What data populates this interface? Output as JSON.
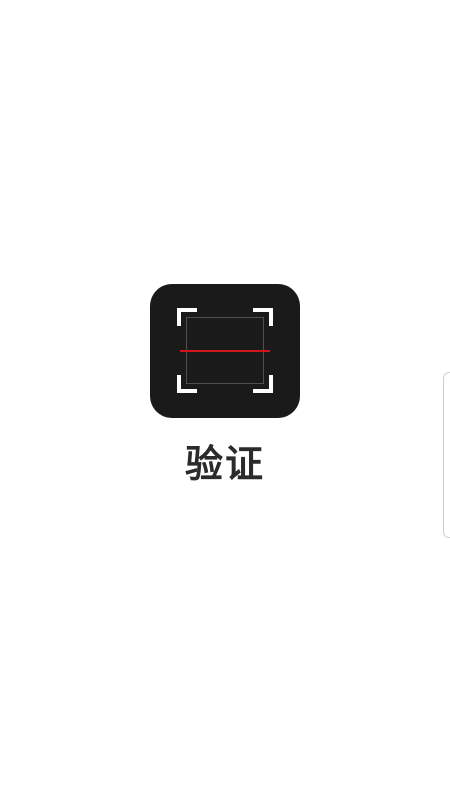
{
  "app": {
    "title": "验证",
    "icon": "scanner-icon"
  },
  "colors": {
    "background": "#ffffff",
    "icon_background": "#1b1a1b",
    "scan_line": "#d0161a",
    "title_text": "#2b2b2b"
  },
  "edge_panel": {
    "icon": "edge-panel-handle"
  }
}
